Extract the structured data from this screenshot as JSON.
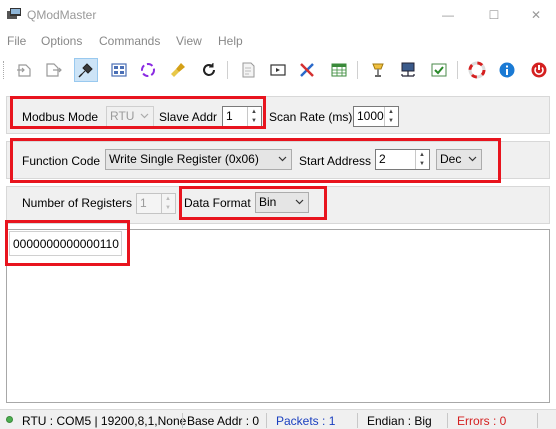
{
  "window": {
    "title": "QModMaster"
  },
  "menu": [
    "File",
    "Options",
    "Commands",
    "View",
    "Help"
  ],
  "toolbar": {
    "icons": [
      "connect-icon",
      "disconnect-icon",
      "plug-icon",
      "read-write-icon",
      "scan-icon",
      "clear-icon",
      "reset-icon",
      "log-icon",
      "bus-monitor-icon",
      "tools-icon",
      "table-icon",
      "settings-icon",
      "network-icon",
      "checkbox-icon",
      "help-icon",
      "info-icon",
      "exit-icon"
    ]
  },
  "row1": {
    "mode_label": "Modbus Mode",
    "mode_value": "RTU",
    "slave_label": "Slave Addr",
    "slave_value": "1",
    "scan_label": "Scan Rate (ms)",
    "scan_value": "1000"
  },
  "row2": {
    "function_label": "Function Code",
    "function_value": "Write Single Register (0x06)",
    "start_label": "Start Address",
    "start_value": "2",
    "format_value": "Dec"
  },
  "row3": {
    "num_label": "Number of Registers",
    "num_value": "1",
    "data_format_label": "Data Format",
    "data_format_value": "Bin"
  },
  "registers": [
    "0000000000000110"
  ],
  "status": {
    "connection": "RTU : COM5 | 19200,8,1,None",
    "base_addr": "Base Addr : 0",
    "packets": "Packets : 1",
    "endian": "Endian : Big",
    "errors": "Errors : 0"
  },
  "colors": {
    "highlight": "#e8141e",
    "packets": "#1a3fbf",
    "errors": "#d42020",
    "led": "#4caf50"
  }
}
